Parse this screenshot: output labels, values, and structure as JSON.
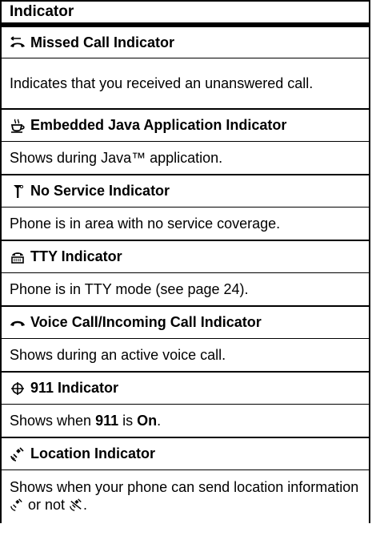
{
  "header": "Indicator",
  "rows": [
    {
      "icon": "missed-call-icon",
      "title": "Missed Call Indicator",
      "desc": "Indicates that you received an unanswered call."
    },
    {
      "icon": "java-cup-icon",
      "title": "Embedded Java Application Indicator",
      "desc": "Shows during Java™ application."
    },
    {
      "icon": "no-service-antenna-icon",
      "title": "No Service Indicator",
      "desc": "Phone is in area with no service coverage."
    },
    {
      "icon": "tty-icon",
      "title": "TTY Indicator",
      "desc": "Phone is in TTY mode (see page 24)."
    },
    {
      "icon": "voice-call-handset-icon",
      "title": "Voice Call/Incoming Call Indicator",
      "desc": "Shows during an active voice call."
    },
    {
      "icon": "911-crosshair-icon",
      "title": "911 Indicator",
      "desc_parts": [
        "Shows when ",
        "911",
        " is ",
        "On",
        "."
      ]
    },
    {
      "icon": "location-satellite-icon",
      "title": "Location Indicator",
      "desc_parts": [
        "Shows when your phone can send location information ",
        " or not ",
        "."
      ]
    }
  ]
}
